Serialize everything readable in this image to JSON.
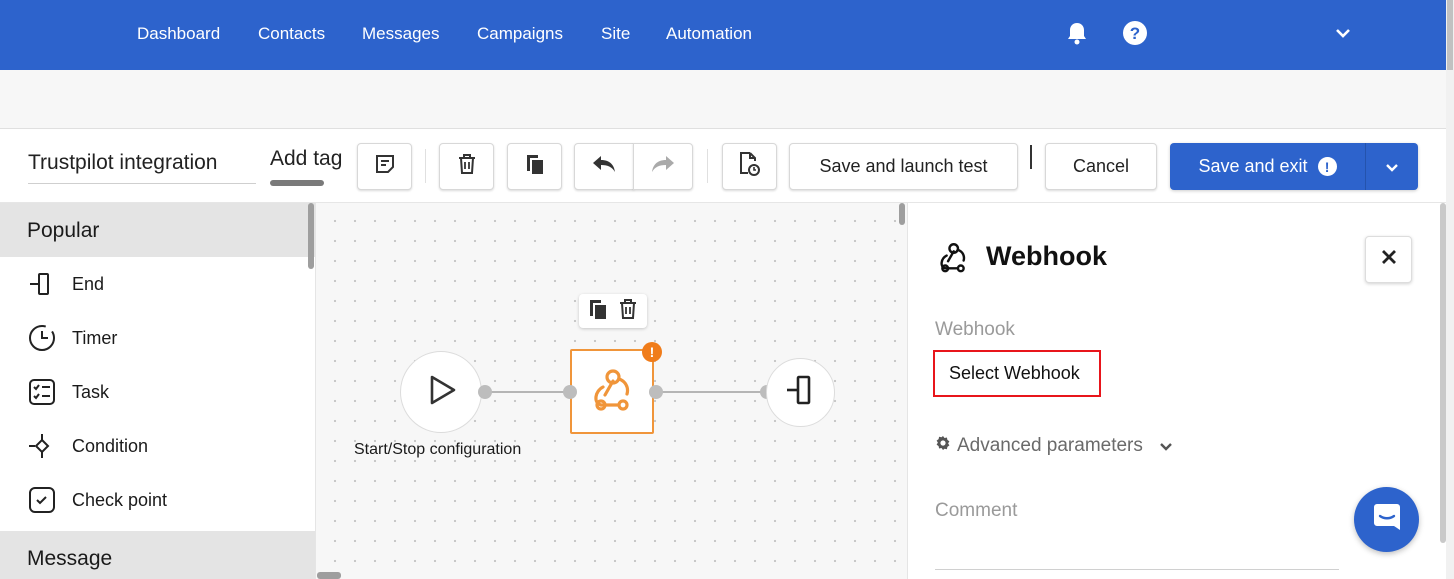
{
  "nav": {
    "items": [
      "Dashboard",
      "Contacts",
      "Messages",
      "Campaigns",
      "Site",
      "Automation"
    ],
    "icons": [
      "bell-icon",
      "help-circle-icon",
      "chevron-down-icon"
    ]
  },
  "toolbar": {
    "flow_name": "Trustpilot integration",
    "add_tag": "Add tag",
    "save_launch_test": "Save and launch test",
    "cancel": "Cancel",
    "save_exit": "Save and exit"
  },
  "sidebar": {
    "section_popular": "Popular",
    "items": [
      {
        "label": "End",
        "icon": "end-icon"
      },
      {
        "label": "Timer",
        "icon": "timer-icon"
      },
      {
        "label": "Task",
        "icon": "task-icon"
      },
      {
        "label": "Condition",
        "icon": "condition-icon"
      },
      {
        "label": "Check point",
        "icon": "check-point-icon"
      }
    ],
    "section_message": "Message"
  },
  "canvas": {
    "start_label": "Start/Stop configuration",
    "alert_mark": "!"
  },
  "panel": {
    "title": "Webhook",
    "webhook_label": "Webhook",
    "select_webhook": "Select Webhook",
    "advanced_parameters": "Advanced parameters",
    "comment_label": "Comment"
  },
  "colors": {
    "brand_blue": "#2d63cc",
    "node_orange": "#f0953a",
    "alert_orange": "#f07c1a",
    "highlight_red": "#e8151b"
  }
}
